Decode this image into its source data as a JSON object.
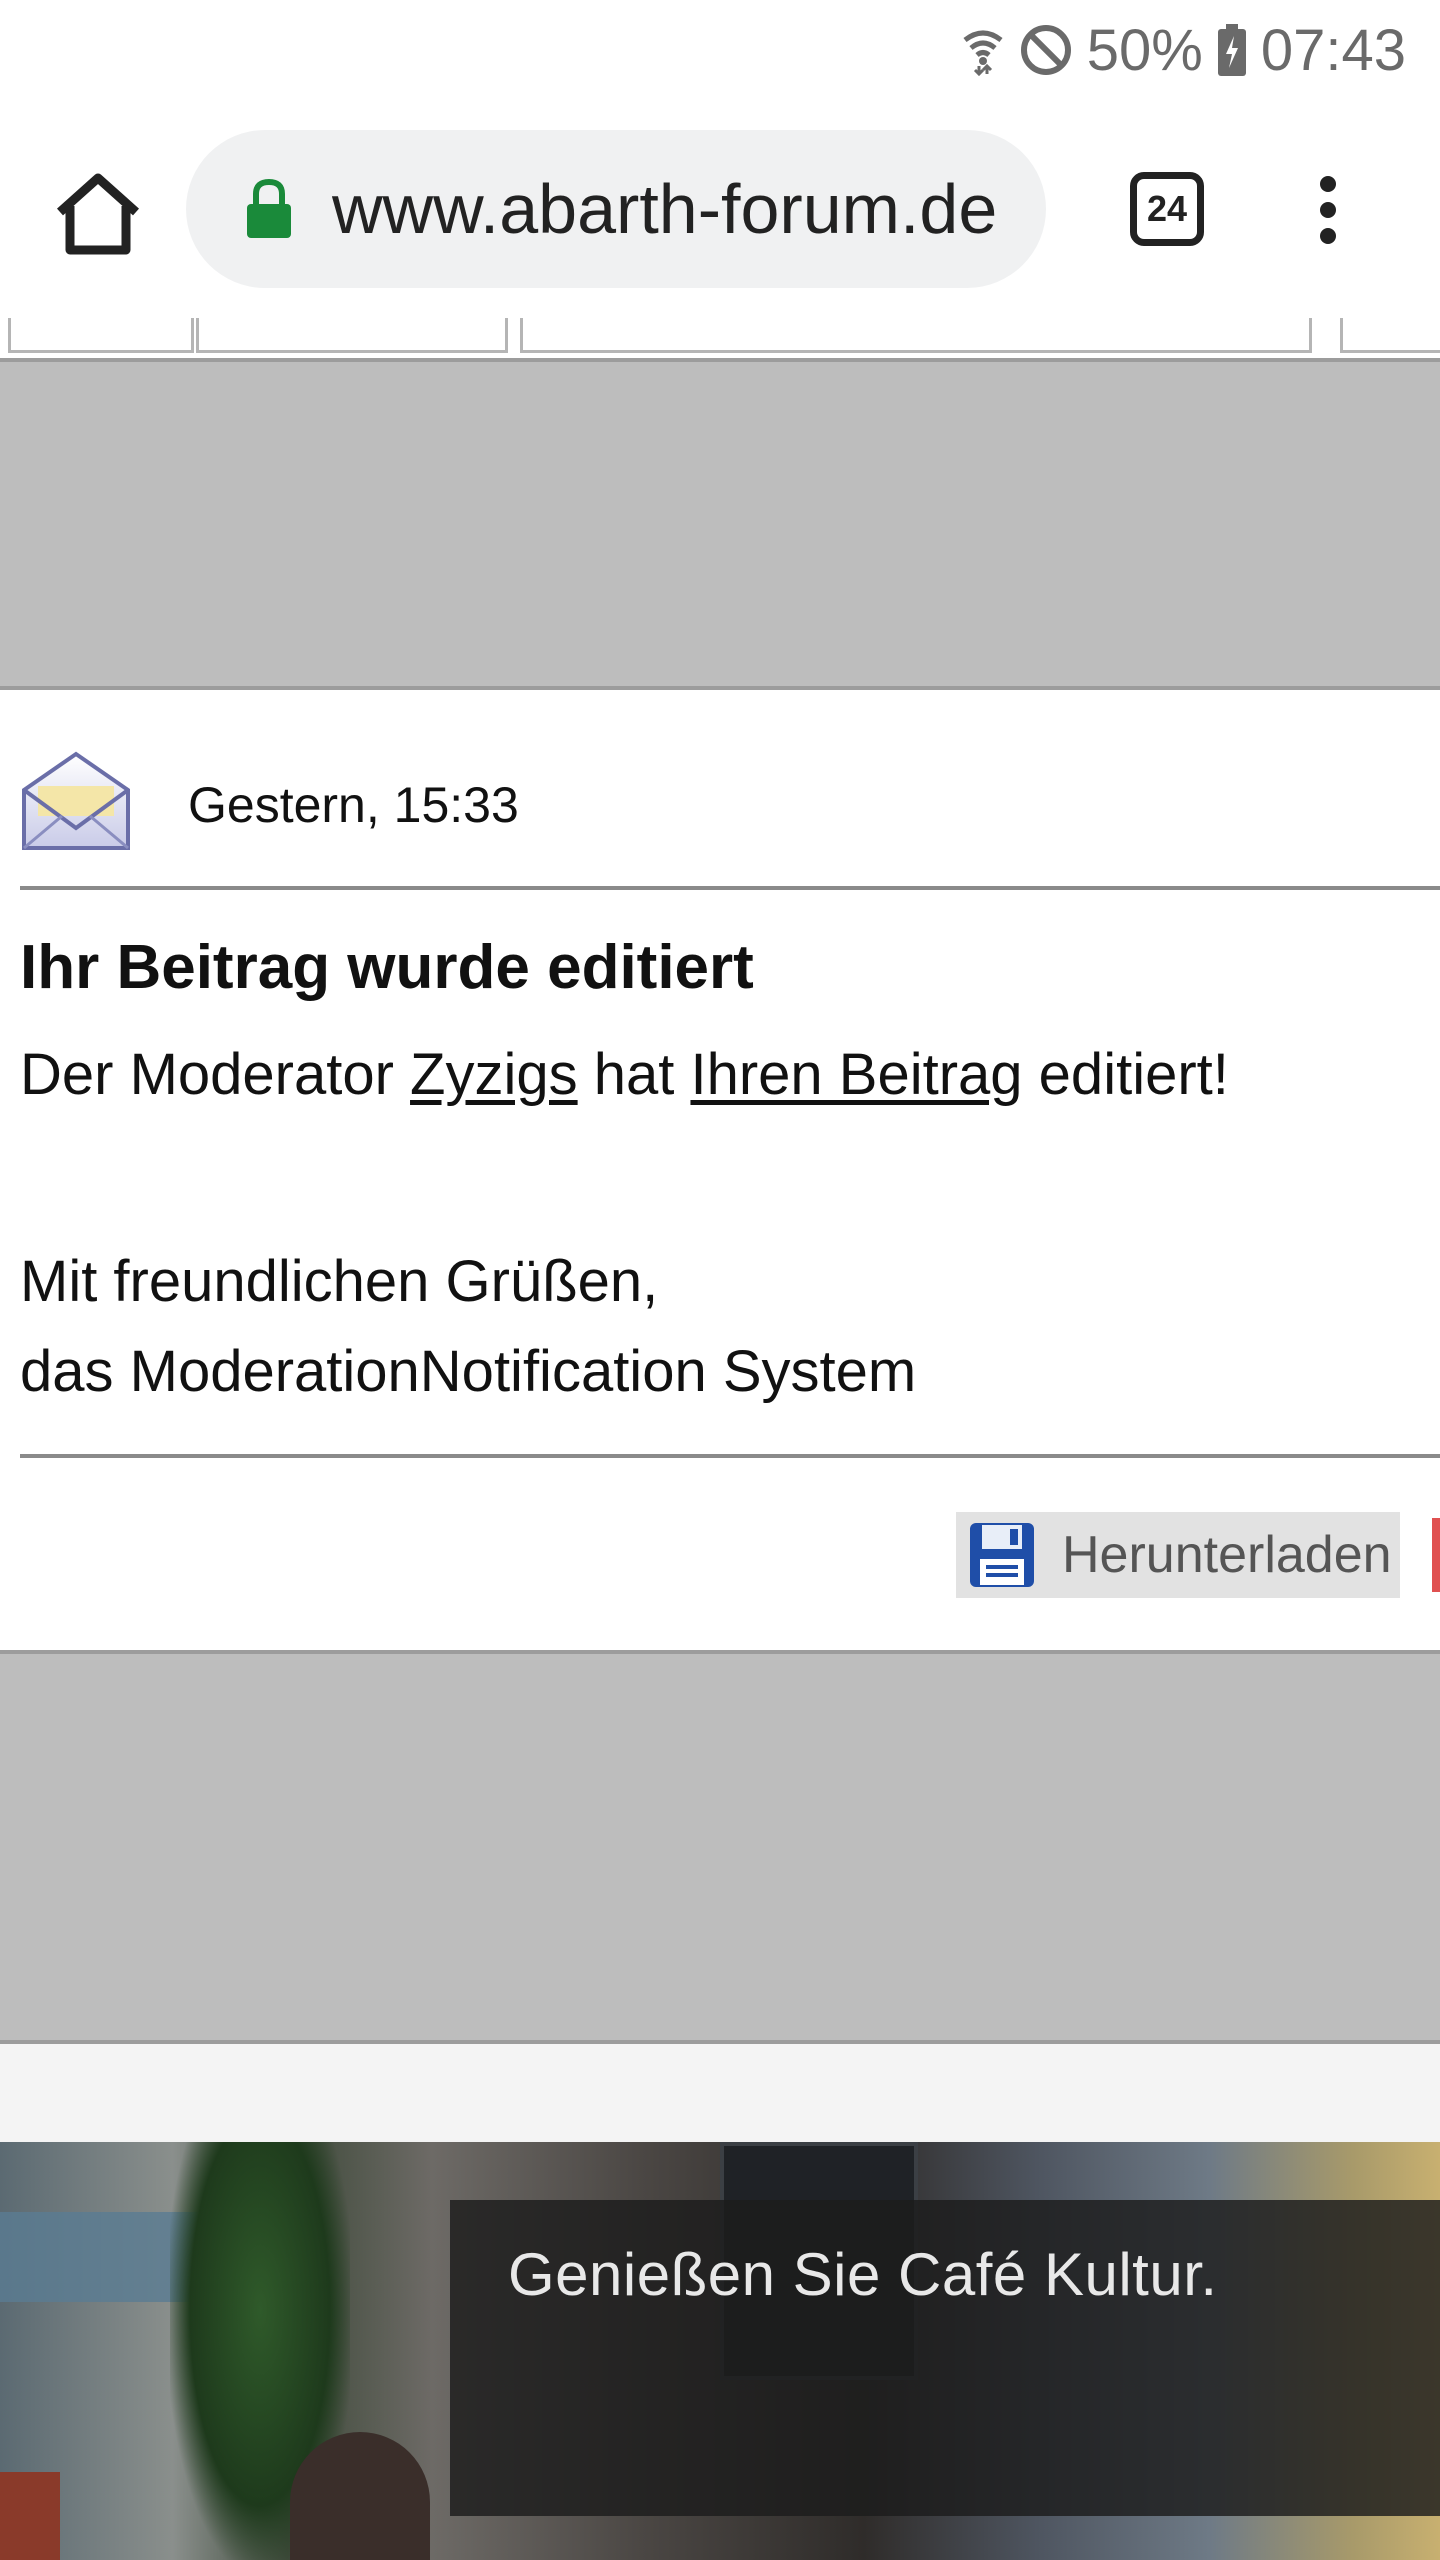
{
  "status_bar": {
    "battery_percent": "50%",
    "time": "07:43",
    "icons": [
      "wifi-icon",
      "do-not-disturb-icon",
      "battery-charging-icon"
    ]
  },
  "browser": {
    "url_display": "www.abarth-forum.de",
    "tab_count": "24",
    "icons": [
      "home-icon",
      "lock-icon",
      "tabs-icon",
      "overflow-menu-icon"
    ],
    "lock_color": "#1a8a3a"
  },
  "message": {
    "date": "Gestern, 15:33",
    "title": "Ihr Beitrag wurde editiert",
    "body_prefix": "Der Moderator ",
    "moderator_link": "Zyzigs",
    "body_middle": " hat ",
    "post_link": "Ihren Beitrag",
    "body_suffix": " editiert!",
    "greeting_line1": "Mit freundlichen Grüßen,",
    "greeting_line2": "das ModerationNotification System",
    "download_label": "Herunterladen",
    "icons": [
      "envelope-icon",
      "floppy-disk-icon"
    ]
  },
  "ad": {
    "caption": "Genießen Sie Café Kultur."
  },
  "colors": {
    "gray_band": "#bdbdbd",
    "divider": "#8a8a8a",
    "download_bg": "#e2e2e2"
  }
}
